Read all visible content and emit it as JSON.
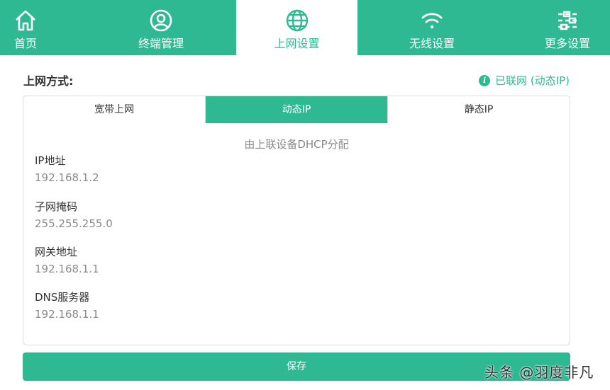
{
  "nav": {
    "items": [
      {
        "label": "首页",
        "icon": "home-icon"
      },
      {
        "label": "终端管理",
        "icon": "user-icon"
      },
      {
        "label": "上网设置",
        "icon": "globe-icon",
        "active": true
      },
      {
        "label": "无线设置",
        "icon": "wifi-icon"
      },
      {
        "label": "更多设置",
        "icon": "sliders-icon"
      }
    ]
  },
  "page": {
    "title": "上网方式:",
    "status": "已联网 (动态IP)"
  },
  "tabs": [
    {
      "label": "宽带上网"
    },
    {
      "label": "动态IP",
      "active": true
    },
    {
      "label": "静态IP"
    }
  ],
  "panel": {
    "note": "由上联设备DHCP分配",
    "fields": [
      {
        "label": "IP地址",
        "value": "192.168.1.2"
      },
      {
        "label": "子网掩码",
        "value": "255.255.255.0"
      },
      {
        "label": "网关地址",
        "value": "192.168.1.1"
      },
      {
        "label": "DNS服务器",
        "value": "192.168.1.1"
      }
    ]
  },
  "save_label": "保存",
  "watermark": "头条 @羽度非凡",
  "colors": {
    "accent": "#2fb993",
    "text": "#333333",
    "muted": "#8a8a8a",
    "border": "#dcdcdc"
  }
}
